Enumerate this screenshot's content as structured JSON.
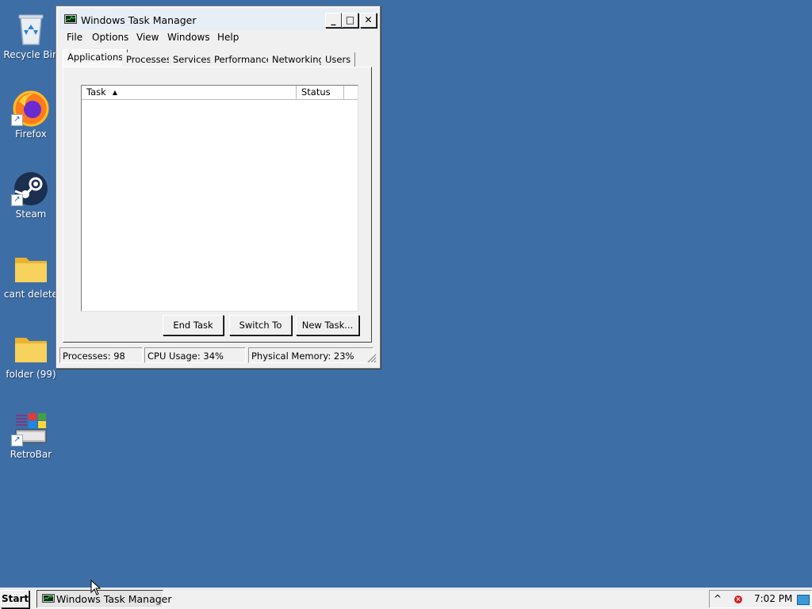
{
  "desktop": {
    "background": "#3e6ea6",
    "icons": [
      {
        "label": "Recycle Bin",
        "icon": "recycle-bin-icon"
      },
      {
        "label": "Firefox",
        "icon": "firefox-icon"
      },
      {
        "label": "Steam",
        "icon": "steam-icon"
      },
      {
        "label": "cant delete",
        "icon": "folder-icon"
      },
      {
        "label": "folder (99)",
        "icon": "folder-icon"
      },
      {
        "label": "RetroBar",
        "icon": "retrobar-icon"
      }
    ]
  },
  "window": {
    "title": "Windows Task Manager",
    "controls": {
      "minimize": "_",
      "maximize": "□",
      "close": "✕"
    },
    "menu": [
      "File",
      "Options",
      "View",
      "Windows",
      "Help"
    ],
    "tabs": [
      "Applications",
      "Processes",
      "Services",
      "Performance",
      "Networking",
      "Users"
    ],
    "active_tab": "Applications",
    "list": {
      "columns": [
        "Task",
        "Status"
      ],
      "sort_indicator": "▲",
      "rows": []
    },
    "buttons": {
      "end_task": "End Task",
      "switch_to": "Switch To",
      "new_task": "New Task..."
    },
    "status": {
      "processes": "Processes: 98",
      "cpu": "CPU Usage: 34%",
      "memory": "Physical Memory: 23%"
    }
  },
  "taskbar": {
    "start": "Start",
    "tasks": [
      {
        "label": "Windows Task Manager",
        "icon": "task-manager-icon"
      }
    ],
    "tray": {
      "expand": "^",
      "clock": "7:02 PM"
    }
  }
}
